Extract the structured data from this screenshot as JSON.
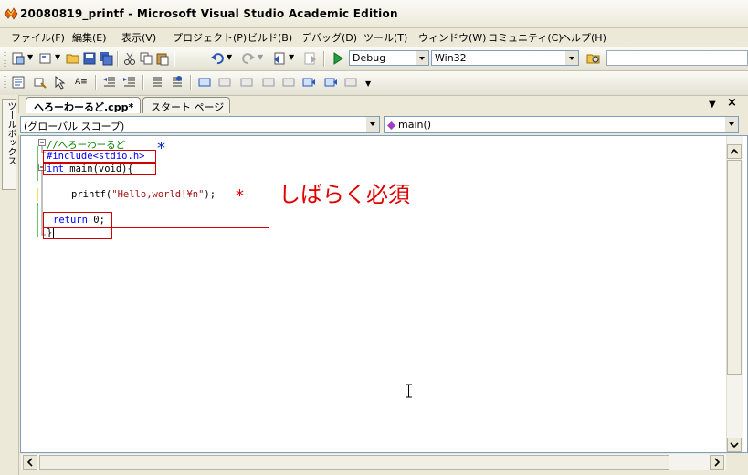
{
  "window": {
    "title": "20080819_printf - Microsoft Visual Studio Academic Edition"
  },
  "menu": [
    "ファイル(F)",
    "編集(E)",
    "表示(V)",
    "プロジェクト(P)",
    "ビルド(B)",
    "デバッグ(D)",
    "ツール(T)",
    "ウィンドウ(W)",
    "コミュニティ(C)",
    "ヘルプ(H)"
  ],
  "toolbar": {
    "config": "Debug",
    "platform": "Win32"
  },
  "toolbox_label": "ツールボックス",
  "tabs": {
    "active": "へろーわーるど.cpp*",
    "start": "スタート ページ"
  },
  "nav": {
    "scope": "(グローバル スコープ)",
    "member": "main()"
  },
  "code": {
    "comment": "//へろーわーるど",
    "include": "#include<stdio.h>",
    "int_kw": "int",
    "main_sig": " main(void){",
    "printf_pre": "printf(",
    "printf_str": "\"Hello,world!¥n\"",
    "printf_post": ");",
    "return_kw": "return",
    "return_val": " 0;",
    "close": "}"
  },
  "annotations": {
    "star1": "*",
    "star2": "*",
    "note": "しばらく必須"
  },
  "colors": {
    "annotation": "#e00000",
    "keyword": "#0000ff",
    "comment": "#008000",
    "string": "#a31515",
    "change_bar": "#6fc16f",
    "unsaved_bar": "#f0e060"
  }
}
